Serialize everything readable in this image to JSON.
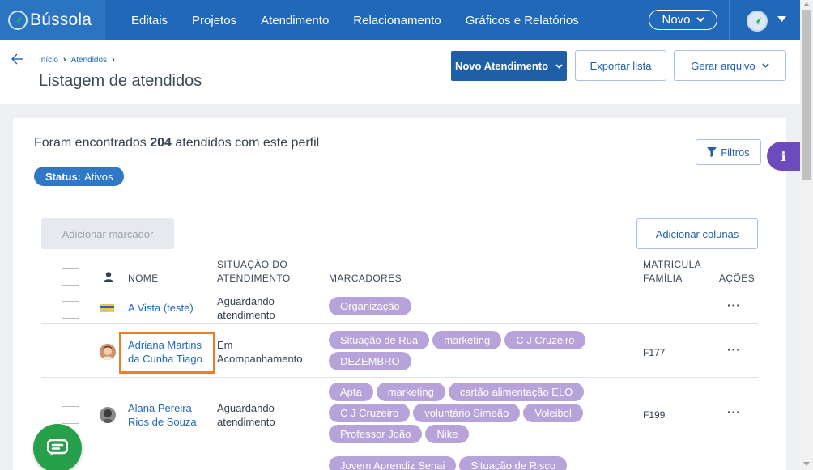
{
  "app": {
    "name": "Bússola"
  },
  "nav": {
    "links": [
      "Editais",
      "Projetos",
      "Atendimento",
      "Relacionamento",
      "Gráficos e Relatórios"
    ],
    "novo_label": "Novo"
  },
  "breadcrumb": {
    "items": [
      "Início",
      "Atendidos"
    ]
  },
  "page": {
    "title": "Listagem de atendidos"
  },
  "actions": {
    "novo_atendimento": "Novo Atendimento",
    "exportar_lista": "Exportar lista",
    "gerar_arquivo": "Gerar arquivo"
  },
  "results": {
    "prefix": "Foram encontrados",
    "count": "204",
    "suffix": "atendidos com este perfil"
  },
  "filters": {
    "status_key": "Status:",
    "status_value": "Ativos",
    "filtros_label": "Filtros"
  },
  "info_tab": {
    "label": "i"
  },
  "toolbar": {
    "adicionar_marcador": "Adicionar marcador",
    "adicionar_colunas": "Adicionar colunas"
  },
  "table": {
    "headers": {
      "nome": "NOME",
      "situacao_1": "SITUAÇÃO DO",
      "situacao_2": "ATENDIMENTO",
      "marcadores": "MARCADORES",
      "matricula_1": "MATRICULA",
      "matricula_2": "FAMÍLIA",
      "acoes": "AÇÕES"
    },
    "rows": [
      {
        "name_1": "A Vista (teste)",
        "name_2": "",
        "sit_1": "Aguardando",
        "sit_2": "atendimento",
        "tags": [
          "Organização"
        ],
        "matricula": "",
        "actions": "···"
      },
      {
        "name_1": "Adriana Martins",
        "name_2": "da Cunha Tiago",
        "sit_1": "Em",
        "sit_2": "Acompanhamento",
        "tags": [
          "Situação de Rua",
          "marketing",
          "C J Cruzeiro",
          "DEZEMBRO"
        ],
        "matricula": "F177",
        "actions": "···"
      },
      {
        "name_1": "Alana Pereira",
        "name_2": "Rios de Souza",
        "sit_1": "Aguardando",
        "sit_2": "atendimento",
        "tags": [
          "Apta",
          "marketing",
          "cartão alimentação ELO",
          "C J Cruzeiro",
          "voluntário Simeão",
          "Voleibol",
          "Professor João",
          "Nike"
        ],
        "matricula": "F199",
        "actions": "···"
      },
      {
        "tags": [
          "Jovem Aprendiz Senai",
          "Situação de Risco"
        ]
      }
    ]
  },
  "colors": {
    "nav": "#2169b8",
    "primary": "#1f5fa7",
    "tag": "#b7a3d9",
    "highlight": "#f07d24",
    "chat": "#26a04a",
    "info": "#6c4bbf"
  }
}
